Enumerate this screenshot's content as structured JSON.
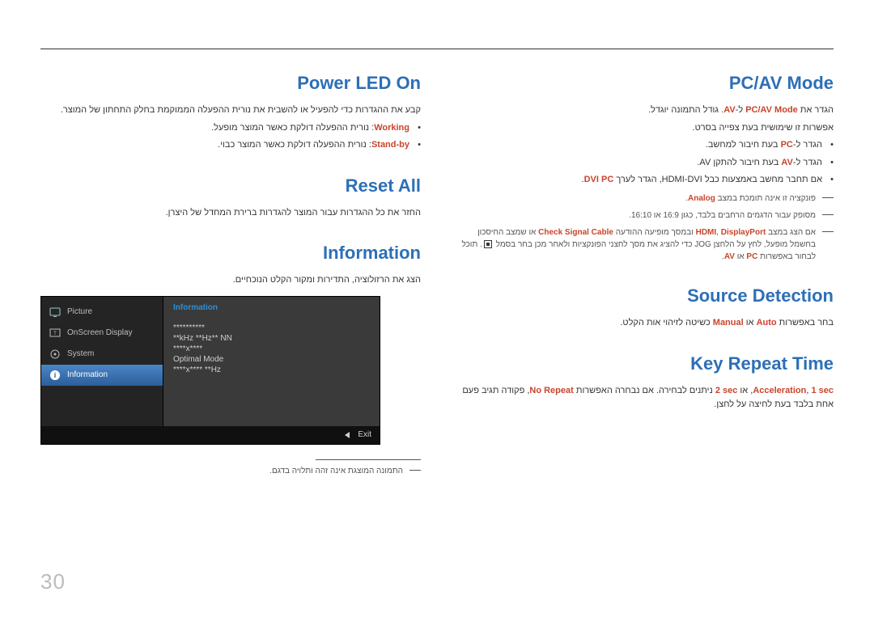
{
  "page_number": "30",
  "left": {
    "power_led": {
      "title": "Power LED On",
      "intro": "קבע את ההגדרות כדי להפעיל או להשבית את נורית ההפעלה הממוקמת בחלק התחתון של המוצר.",
      "items": [
        {
          "kw": "Working",
          "text": ": נורית ההפעלה דולקת כאשר המוצר מופעל."
        },
        {
          "kw": "Stand-by",
          "text": ": נורית ההפעלה דולקת כאשר המוצר כבוי."
        }
      ]
    },
    "reset_all": {
      "title": "Reset All",
      "text": "החזר את כל ההגדרות עבור המוצר להגדרות ברירת המחדל של היצרן."
    },
    "information": {
      "title": "Information",
      "text": "הצג את הרזולוציה, התדירות ומקור הקלט הנוכחיים.",
      "osd": {
        "sidebar": [
          {
            "icon": "picture",
            "label": "Picture",
            "active": false
          },
          {
            "icon": "onscreen",
            "label": "OnScreen Display",
            "active": false
          },
          {
            "icon": "system",
            "label": "System",
            "active": false
          },
          {
            "icon": "info",
            "label": "Information",
            "active": true
          }
        ],
        "panel_title": "Information",
        "lines": [
          "**********",
          "**kHz **Hz** NN",
          "****x****",
          "",
          "Optimal Mode",
          "****x**** **Hz"
        ],
        "exit": "Exit"
      },
      "footnote": "התמונה המוצגת אינה זהה ותלויה בדגם."
    }
  },
  "right": {
    "pcav": {
      "title": "PC/AV Mode",
      "line1_pre": "הגדר את ",
      "line1_kw1": "PC/AV Mode",
      "line1_mid": " ל-",
      "line1_kw2": "AV",
      "line1_post": ". גודל התמונה יוגדל.",
      "line2": "אפשרות זו שימושית בעת צפייה בסרט.",
      "items": [
        {
          "pre": "הגדר ל-",
          "kw": "PC",
          "post": " בעת חיבור למחשב."
        },
        {
          "pre": "הגדר ל-",
          "kw": "AV",
          "post": " בעת חיבור להתקן AV."
        },
        {
          "pre": "אם תחבר מחשב באמצעות כבל HDMI-DVI, הגדר לערך ",
          "kw": "DVI PC",
          "post": "."
        }
      ],
      "notes": [
        {
          "pre": "פונקציה זו אינה תומכת במצב ",
          "kw": "Analog",
          "post": "."
        },
        {
          "text": "מסופק עבור הדגמים הרחבים בלבד, כגון 16:9 או 16:10."
        },
        {
          "pre": "אם הצג במצב ",
          "kw1": "HDMI",
          "mid1": ", ",
          "kw2": "DisplayPort",
          "mid2": " ובמסך מופיעה ההודעה ",
          "kw3": "Check Signal Cable",
          "mid3": " או שמצב החיסכון בחשמל מופעל, לחץ על הלחצן JOG כדי להציג את מסך לחצני הפונקציות ולאחר מכן בחר בסמל ",
          "icon": true,
          "mid4": ". תוכל לבחור באפשרות ",
          "kw4": "PC",
          "mid5": " או ",
          "kw5": "AV",
          "post": "."
        }
      ]
    },
    "source": {
      "title": "Source Detection",
      "pre": "בחר באפשרות ",
      "kw1": "Auto",
      "mid": " או ",
      "kw2": "Manual",
      "post": " כשיטה לזיהוי אות הקלט."
    },
    "key_repeat": {
      "title": "Key Repeat Time",
      "kw1": "Acceleration",
      "mid1": ", ",
      "kw2": "1 sec",
      "mid2": ", או ",
      "kw3": "2 sec",
      "mid3": " ניתנים לבחירה. אם נבחרה האפשרות ",
      "kw4": "No Repeat",
      "mid4": ", פקודה תגיב פעם אחת בלבד בעת לחיצה על לחצן."
    }
  }
}
